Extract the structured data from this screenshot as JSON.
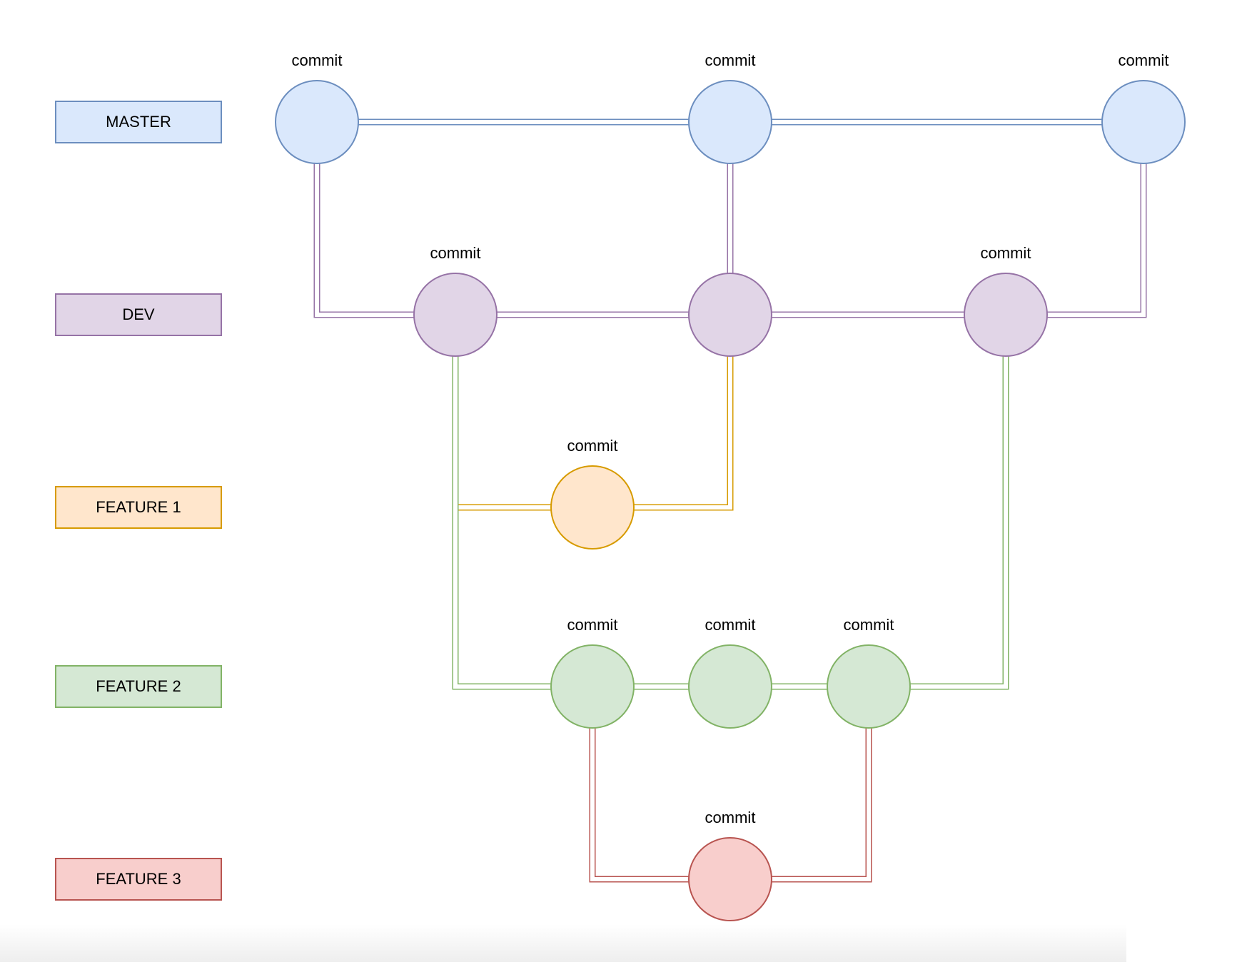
{
  "branches": [
    {
      "id": "master",
      "label": "MASTER",
      "fill": "#dae8fc",
      "stroke": "#6c8ebf"
    },
    {
      "id": "dev",
      "label": "DEV",
      "fill": "#e1d5e7",
      "stroke": "#9673a6"
    },
    {
      "id": "feature1",
      "label": "FEATURE 1",
      "fill": "#ffe6cc",
      "stroke": "#d79b00"
    },
    {
      "id": "feature2",
      "label": "FEATURE 2",
      "fill": "#d5e8d4",
      "stroke": "#82b366"
    },
    {
      "id": "feature3",
      "label": "FEATURE 3",
      "fill": "#f8cecc",
      "stroke": "#b85450"
    }
  ],
  "commits": [
    {
      "id": "m1",
      "branch": "master",
      "label": "commit"
    },
    {
      "id": "m2",
      "branch": "master",
      "label": "commit"
    },
    {
      "id": "m3",
      "branch": "master",
      "label": "commit"
    },
    {
      "id": "d1",
      "branch": "dev",
      "label": "commit"
    },
    {
      "id": "d2",
      "branch": "dev",
      "label": ""
    },
    {
      "id": "d3",
      "branch": "dev",
      "label": "commit"
    },
    {
      "id": "f1a",
      "branch": "feature1",
      "label": "commit"
    },
    {
      "id": "f2a",
      "branch": "feature2",
      "label": "commit"
    },
    {
      "id": "f2b",
      "branch": "feature2",
      "label": "commit"
    },
    {
      "id": "f2c",
      "branch": "feature2",
      "label": "commit"
    },
    {
      "id": "f3a",
      "branch": "feature3",
      "label": "commit"
    }
  ],
  "edges": [
    {
      "from": "m1",
      "to": "m2",
      "color": "master"
    },
    {
      "from": "m2",
      "to": "m3",
      "color": "master"
    },
    {
      "from": "m1",
      "to": "d1",
      "color": "dev"
    },
    {
      "from": "m2",
      "to": "d2",
      "color": "dev"
    },
    {
      "from": "d3",
      "to": "m3",
      "color": "dev"
    },
    {
      "from": "d1",
      "to": "d2",
      "color": "dev"
    },
    {
      "from": "d2",
      "to": "d3",
      "color": "dev"
    },
    {
      "from": "d1",
      "to": "f1a",
      "color": "feature1"
    },
    {
      "from": "f1a",
      "to": "d2",
      "color": "feature1"
    },
    {
      "from": "d1",
      "to": "f2a",
      "color": "feature2"
    },
    {
      "from": "f2a",
      "to": "f2b",
      "color": "feature2"
    },
    {
      "from": "f2b",
      "to": "f2c",
      "color": "feature2"
    },
    {
      "from": "f2c",
      "to": "d3",
      "color": "feature2"
    },
    {
      "from": "f2a",
      "to": "f3a",
      "color": "feature3"
    },
    {
      "from": "f3a",
      "to": "f2c",
      "color": "feature3"
    }
  ]
}
